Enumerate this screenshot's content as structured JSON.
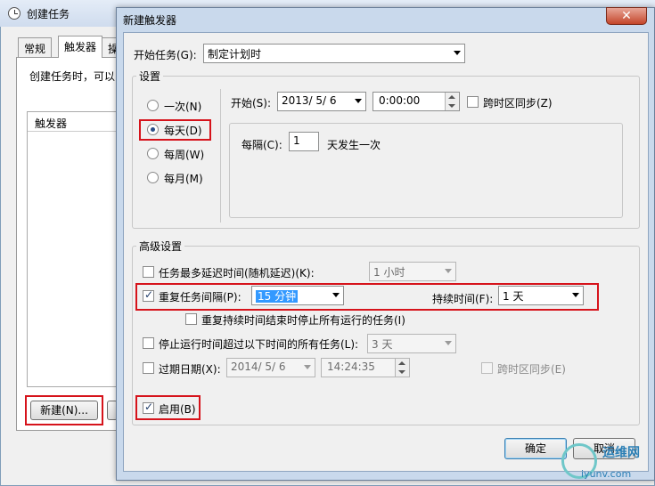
{
  "background_window": {
    "title": "创建任务",
    "tabs": [
      "常规",
      "触发器",
      "操"
    ],
    "description": "创建任务时，可以",
    "list_header": "触发器",
    "new_button": "新建(N)..."
  },
  "dialog": {
    "title": "新建触发器",
    "close_label": "✕",
    "begin_task_label": "开始任务(G):",
    "begin_task_value": "制定计划时",
    "settings_group": "设置",
    "schedule_options": [
      "一次(N)",
      "每天(D)",
      "每周(W)",
      "每月(M)"
    ],
    "start_label": "开始(S):",
    "start_date": "2013/ 5/ 6",
    "start_time": "0:00:00",
    "sync_tz_label": "跨时区同步(Z)",
    "recur_label": "每隔(C):",
    "recur_value": "1",
    "recur_suffix": "天发生一次",
    "advanced_group": "高级设置",
    "delay_label": "任务最多延迟时间(随机延迟)(K):",
    "delay_value": "1 小时",
    "repeat_label": "重复任务间隔(P):",
    "repeat_value": "15 分钟",
    "duration_label": "持续时间(F):",
    "duration_value": "1 天",
    "stop_at_end_label": "重复持续时间结束时停止所有运行的任务(I)",
    "stop_longer_label": "停止运行时间超过以下时间的所有任务(L):",
    "stop_longer_value": "3 天",
    "expire_label": "过期日期(X):",
    "expire_date": "2014/ 5/ 6",
    "expire_time": "14:24:35",
    "expire_sync_label": "跨时区同步(E)",
    "enabled_label": "启用(B)",
    "ok_button": "确定",
    "cancel_button": "取消"
  },
  "watermark": {
    "name": "运维网",
    "url": "iyunv.com"
  }
}
